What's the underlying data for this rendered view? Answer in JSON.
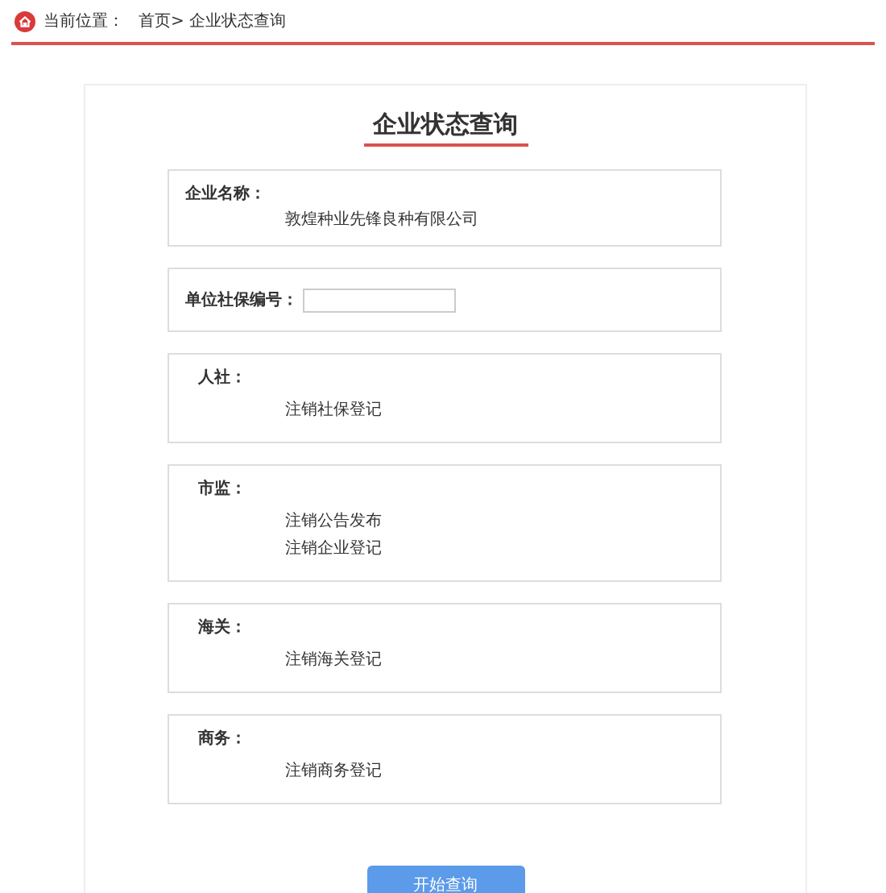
{
  "breadcrumb": {
    "label": "当前位置：",
    "path": "首页> 企业状态查询"
  },
  "title": "企业状态查询",
  "sections": [
    {
      "kind": "info",
      "label": "企业名称：",
      "items": [
        "敦煌种业先锋良种有限公司"
      ]
    },
    {
      "kind": "input",
      "label": "单位社保编号："
    },
    {
      "kind": "list",
      "label": "人社：",
      "items": [
        "注销社保登记"
      ]
    },
    {
      "kind": "list",
      "label": "市监：",
      "items": [
        "注销公告发布",
        "注销企业登记"
      ]
    },
    {
      "kind": "list",
      "label": "海关：",
      "items": [
        "注销海关登记"
      ]
    },
    {
      "kind": "list",
      "label": "商务：",
      "items": [
        "注销商务登记"
      ]
    }
  ],
  "button": "开始查询"
}
